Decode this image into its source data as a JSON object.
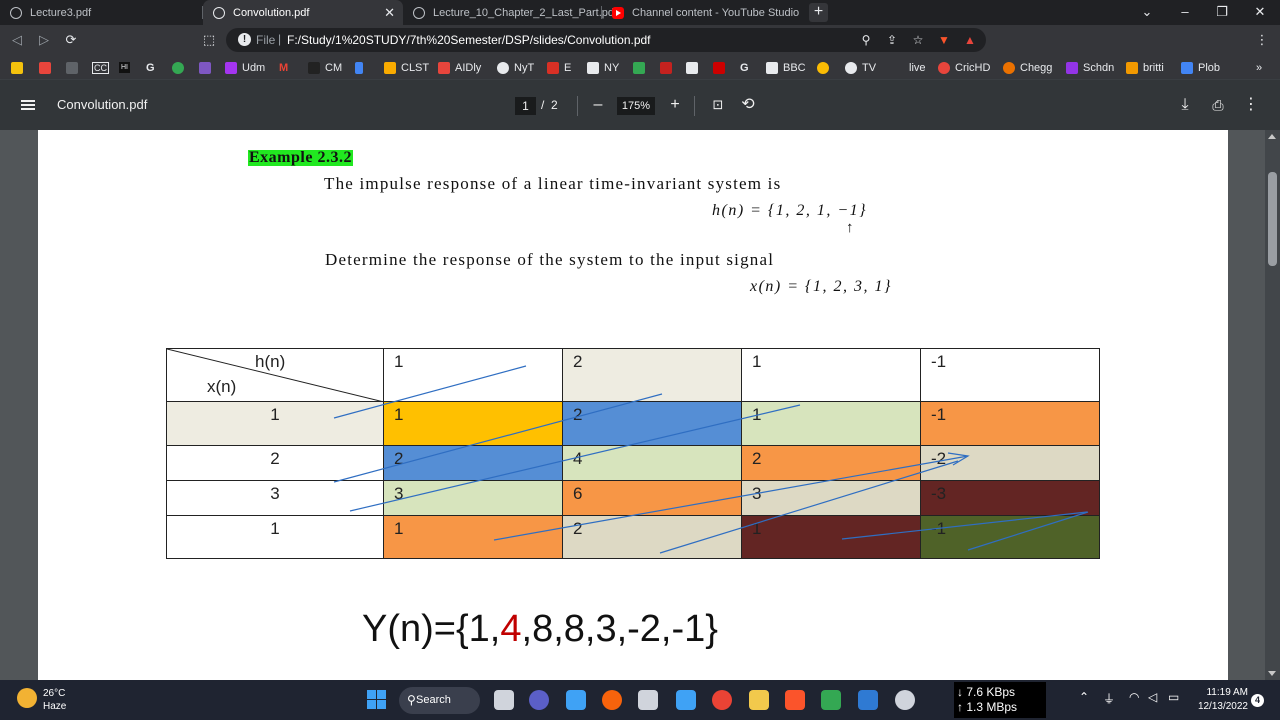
{
  "tabs": [
    {
      "label": "Lecture3.pdf"
    },
    {
      "label": "Convolution.pdf",
      "active": true
    },
    {
      "label": "Lecture_10_Chapter_2_Last_Part.pdf"
    },
    {
      "label": "Channel content - YouTube Studio"
    }
  ],
  "window": {
    "new_tab": "+",
    "minimize": "–",
    "maximize": "❐",
    "close": "✕",
    "tab_close": "✕",
    "tab_search": "⌄"
  },
  "address": {
    "scheme_label": "File",
    "url": "F:/Study/1%20STUDY/7th%20Semester/DSP/slides/Convolution.pdf"
  },
  "bookmarks": [
    {
      "label": "",
      "color": "#f4c20d"
    },
    {
      "label": "",
      "color": "#e8453c"
    },
    {
      "label": "",
      "color": "#5f6368"
    },
    {
      "label": "CC",
      "color": "#444444"
    },
    {
      "label": "HI",
      "color": "#111111"
    },
    {
      "label": "G",
      "color": "#4285f4"
    },
    {
      "label": "",
      "color": "#34a853"
    },
    {
      "label": "",
      "color": "#7e57c2"
    },
    {
      "label": "Udm",
      "color": "#a435f0"
    },
    {
      "label": "M",
      "color": "#ea4335"
    },
    {
      "label": "CM",
      "color": "#222222"
    },
    {
      "label": "",
      "color": "#4285f4"
    },
    {
      "label": "CLST",
      "color": "#f9ab00"
    },
    {
      "label": "AIDly",
      "color": "#e8453c"
    },
    {
      "label": "NyT",
      "color": "#ffffff"
    },
    {
      "label": "E",
      "color": "#d93025"
    },
    {
      "label": "NY",
      "color": "#ffffff"
    },
    {
      "label": "",
      "color": "#34a853"
    },
    {
      "label": "",
      "color": "#c5221f"
    },
    {
      "label": "",
      "color": "#ffffff"
    },
    {
      "label": "",
      "color": "#cc0000"
    },
    {
      "label": "G",
      "color": "#4285f4"
    },
    {
      "label": "BBC",
      "color": "#ffffff"
    },
    {
      "label": "",
      "color": "#fbbc04"
    },
    {
      "label": "TV",
      "color": "#ffffff"
    },
    {
      "label": "live",
      "color": "#35363a"
    },
    {
      "label": "CricHD",
      "color": "#e8453c"
    },
    {
      "label": "Chegg",
      "color": "#eb7100"
    },
    {
      "label": "Schdn",
      "color": "#9334e6"
    },
    {
      "label": "britti",
      "color": "#f29900"
    },
    {
      "label": "Plob",
      "color": "#4285f4"
    }
  ],
  "bookmarks_more": "»",
  "viewer": {
    "title": "Convolution.pdf",
    "page_current": "1",
    "page_sep": "/",
    "page_total": "2",
    "zoom": "175%",
    "zoom_out": "–",
    "zoom_in": "+"
  },
  "doc": {
    "heading": "Example 2.3.2",
    "line1": "The impulse response of a linear time-invariant system is",
    "h_eq": "h(n) = {1, 2, 1, −1}",
    "arrow": "↑",
    "line2": "Determine the response of the system to the input signal",
    "x_eq": "x(n) = {1, 2, 3, 1}",
    "table": {
      "h_label": "h(n)",
      "x_label": "x(n)",
      "h_values": [
        "1",
        "2",
        "1",
        "-1"
      ],
      "rows": [
        {
          "x": "1",
          "cells": [
            "1",
            "2",
            "1",
            "-1"
          ]
        },
        {
          "x": "2",
          "cells": [
            "2",
            "4",
            "2",
            "-2"
          ]
        },
        {
          "x": "3",
          "cells": [
            "3",
            "6",
            "3",
            "-3"
          ]
        },
        {
          "x": "1",
          "cells": [
            "1",
            "2",
            "1",
            "-1"
          ]
        }
      ]
    },
    "result": {
      "prefix": "Y(n)={1,",
      "highlight": "4",
      "suffix": ",8,8,3,-2,-1}"
    }
  },
  "colors": {
    "row_label_bg": "#eeece1",
    "orange": "#f79646",
    "gold": "#ffc000",
    "blue": "#558ed5",
    "light_green": "#d7e4bd",
    "tan": "#ddd9c4",
    "maroon": "#632523",
    "olive": "#4f6228",
    "highlight": "#21e820",
    "result_highlight": "#c00000"
  },
  "cell_colors": [
    [
      "gold",
      "blue",
      "light_green",
      "orange"
    ],
    [
      "blue",
      "light_green",
      "orange",
      "tan"
    ],
    [
      "light_green",
      "orange",
      "tan",
      "maroon"
    ],
    [
      "orange",
      "tan",
      "maroon",
      "olive"
    ]
  ],
  "taskbar": {
    "temp": "26°C",
    "weather": "Haze",
    "search": "Search",
    "net_down": "↓ 7.6 KBps",
    "net_up": "↑ 1.3 MBps",
    "time": "11:19 AM",
    "date": "12/13/2022",
    "notifications": "4"
  }
}
